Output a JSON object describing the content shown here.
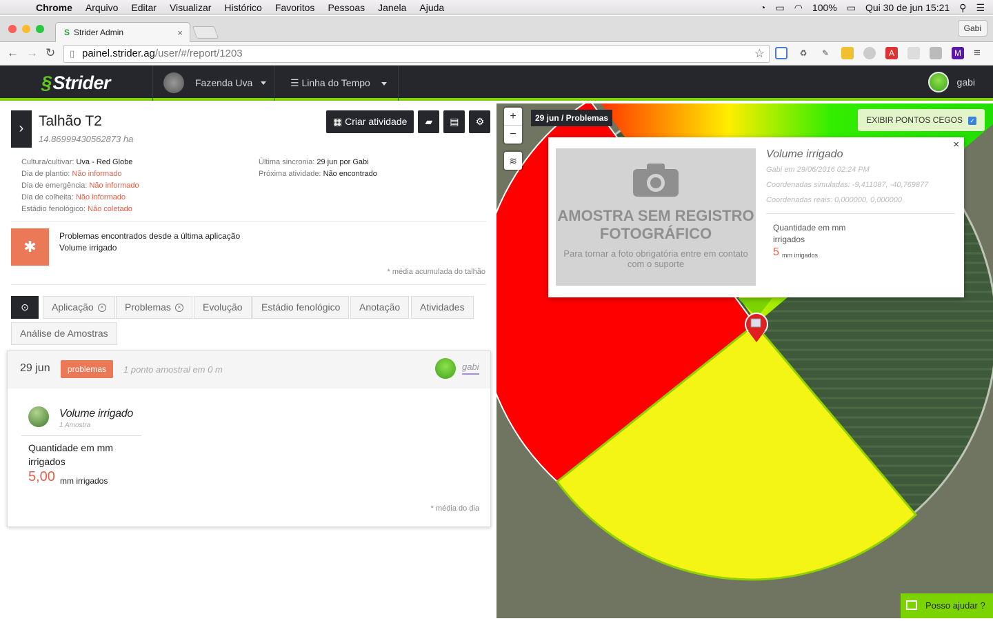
{
  "os_menu": {
    "app": "Chrome",
    "items": [
      "Arquivo",
      "Editar",
      "Visualizar",
      "Histórico",
      "Favoritos",
      "Pessoas",
      "Janela",
      "Ajuda"
    ],
    "battery": "100%",
    "clock": "Qui 30 de jun  15:21"
  },
  "browser": {
    "tab_title": "Strider Admin",
    "profile": "Gabi",
    "url_domain": "painel.strider.ag",
    "url_path": "/user/#/report/1203"
  },
  "app_header": {
    "brand": "Strider",
    "farm": "Fazenda Uva",
    "timeline": "Linha do Tempo",
    "user": "gabi"
  },
  "plot": {
    "title": "Talhão T2",
    "area": "14.86999430562873 ha",
    "actions": {
      "create": "Criar atividade"
    },
    "info_left": [
      {
        "label": "Cultura/cultivar:",
        "value": "Uva - Red Globe",
        "red": false
      },
      {
        "label": "Dia de plantio:",
        "value": "Não informado",
        "red": true
      },
      {
        "label": "Dia de emergência:",
        "value": "Não informado",
        "red": true
      },
      {
        "label": "Dia de colheita:",
        "value": "Não informado",
        "red": true
      },
      {
        "label": "Estádio fenológico:",
        "value": "Não coletado",
        "red": true
      }
    ],
    "info_right": [
      {
        "label": "Última sincronia:",
        "value": "29 jun por Gabi"
      },
      {
        "label": "Próxima atividade:",
        "value": "Não encontrado"
      }
    ],
    "problems_title": "Problemas encontrados desde a última aplicação",
    "problems_item": "Volume irrigado",
    "accumulated_note": "* média acumulada do talhão"
  },
  "tabs": [
    {
      "label": "Aplicação",
      "closable": true
    },
    {
      "label": "Problemas",
      "closable": true
    },
    {
      "label": "Evolução",
      "closable": false
    },
    {
      "label": "Estádio fenológico",
      "closable": false
    },
    {
      "label": "Anotação",
      "closable": false
    },
    {
      "label": "Atividades",
      "closable": false
    },
    {
      "label": "Análise de Amostras",
      "closable": false
    }
  ],
  "report": {
    "date": "29 jun",
    "badge": "problemas",
    "points": "1 ponto amostral em 0 m",
    "user": "gabi",
    "item_title": "Volume irrigado",
    "item_samples": "1 Amostra",
    "metric_label": "Quantidade em mm irrigados",
    "metric_value": "5,00",
    "metric_unit": "mm irrigados",
    "day_note": "* média do dia"
  },
  "map": {
    "label": "29 jun / Problemas",
    "blind_spots": "EXIBIR PONTOS CEGOS",
    "blind_spots_checked": true,
    "popup": {
      "title": "Volume irrigado",
      "meta_by": "Gabi",
      "meta_em": "em",
      "meta_date": "29/06/2016 02:24 PM",
      "sim_label": "Coordenadas simuladas:",
      "sim_value": "-9,411087, -40,769877",
      "real_label": "Coordenadas reais:",
      "real_value": "0,000000, 0,000000",
      "photo_title": "AMOSTRA SEM REGISTRO FOTOGRÁFICO",
      "photo_sub": "Para tornar a foto obrigatória entre em contato com o suporte",
      "metric_label": "Quantidade em mm irrigados",
      "metric_value": "5",
      "metric_unit": "mm irrigados"
    },
    "help": "Posso ajudar ?",
    "colors": {
      "problem": "#ff0000",
      "warning": "#f5f515",
      "ok": "#22dd00"
    }
  }
}
